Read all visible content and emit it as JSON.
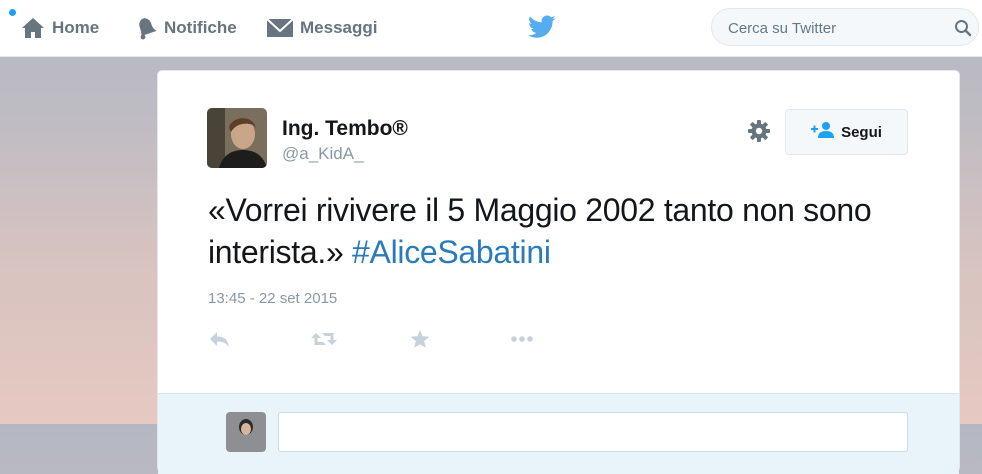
{
  "nav": {
    "home_label": "Home",
    "notifications_label": "Notifiche",
    "messages_label": "Messaggi"
  },
  "search": {
    "placeholder": "Cerca su Twitter"
  },
  "tweet": {
    "fullname": "Ing. Tembo®",
    "username": "@a_KidA_",
    "text": "«Vorrei rivivere il 5 Maggio 2002 tanto non sono interista.» ",
    "hashtag": "#AliceSabatini",
    "timestamp": "13:45 - 22 set 2015",
    "follow_label": "Segui"
  },
  "icons": {
    "home": "home-icon",
    "notifications": "bell-icon",
    "messages": "envelope-icon",
    "logo": "twitter-bird-icon",
    "search": "search-icon",
    "settings": "gear-icon",
    "follow": "add-user-icon",
    "reply": "reply-icon",
    "retweet": "retweet-icon",
    "favorite": "star-icon",
    "more": "more-icon"
  },
  "colors": {
    "accent": "#1da1f2",
    "hashtag": "#2b7bb9",
    "muted": "#8899a6",
    "nav_text": "#66757f",
    "reply_area": "#e8f4f9"
  }
}
